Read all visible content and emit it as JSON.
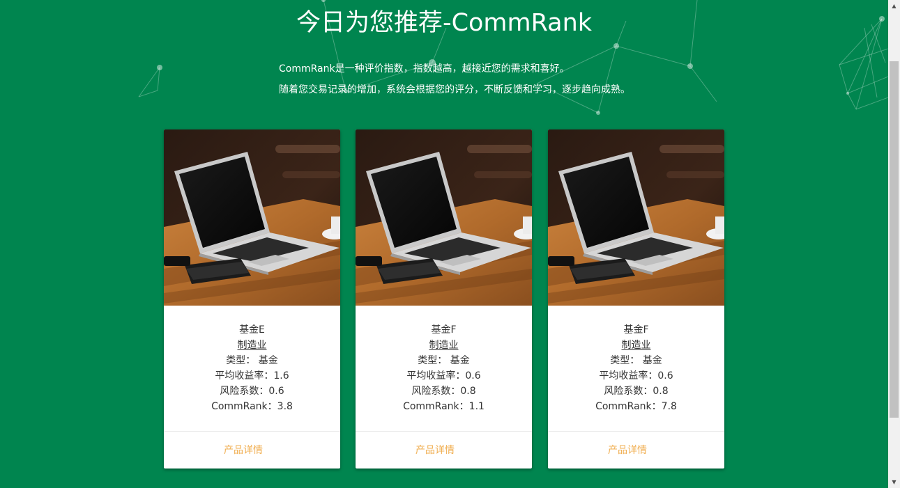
{
  "header": {
    "title": "今日为您推荐-CommRank",
    "intro_line1": "CommRank是一种评价指数，指数越高，越接近您的需求和喜好。",
    "intro_line2": "随着您交易记录的增加，系统会根据您的评分，不断反馈和学习，逐步趋向成熟。"
  },
  "cards": [
    {
      "name": "基金E",
      "industry": "制造业",
      "type_line": "类型： 基金",
      "return_line": "平均收益率：1.6",
      "risk_line": "风险系数：0.6",
      "rank_line": "CommRank：3.8",
      "link": "产品详情",
      "image_icon": "laptop-photo"
    },
    {
      "name": "基金F",
      "industry": "制造业",
      "type_line": "类型： 基金",
      "return_line": "平均收益率：0.6",
      "risk_line": "风险系数：0.8",
      "rank_line": "CommRank：1.1",
      "link": "产品详情",
      "image_icon": "laptop-photo"
    },
    {
      "name": "基金F",
      "industry": "制造业",
      "type_line": "类型： 基金",
      "return_line": "平均收益率：0.6",
      "risk_line": "风险系数：0.8",
      "rank_line": "CommRank：7.8",
      "link": "产品详情",
      "image_icon": "laptop-photo"
    }
  ],
  "scrollbar": {
    "up_icon": "scroll-up-arrow-icon",
    "down_icon": "scroll-down-arrow-icon"
  },
  "colors": {
    "background": "#00854f",
    "link": "#f0ad4e",
    "card": "#ffffff",
    "text": "#333333"
  }
}
